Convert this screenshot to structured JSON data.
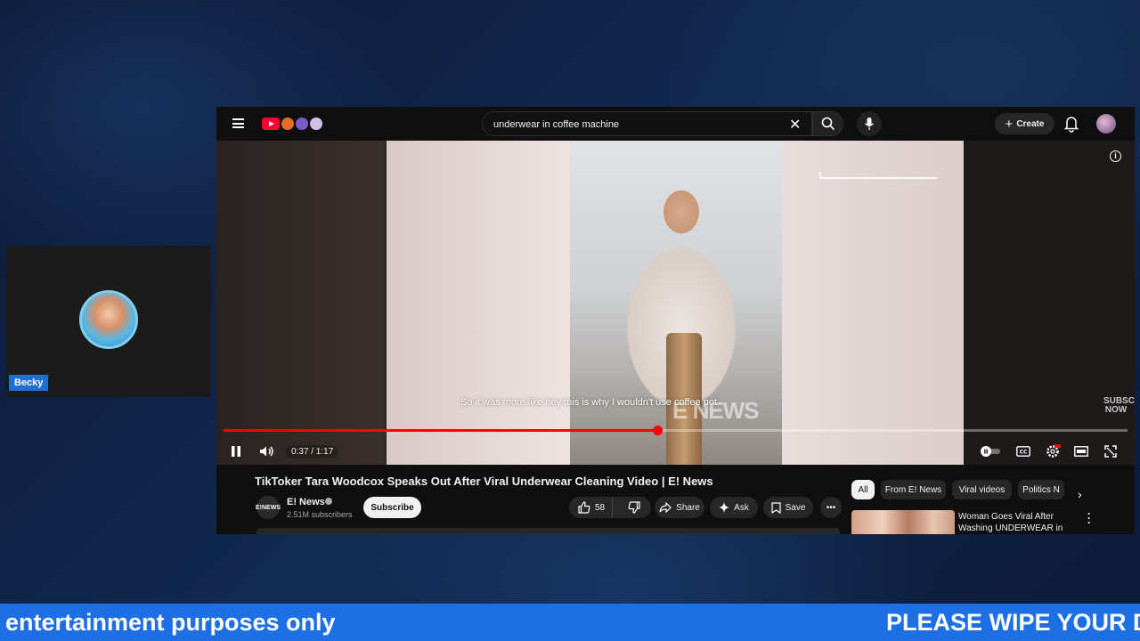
{
  "webcam": {
    "name": "Becky"
  },
  "youtube": {
    "search": {
      "value": "underwear in coffee machine",
      "placeholder": "Search"
    },
    "create_label": "Create",
    "video": {
      "caption": "So it was more like hey this is why I wouldn't use coffee pot",
      "watermark": "E NEWS",
      "subscribe_now": "SUBSCRIBE NOW",
      "time": "0:37 / 1:17",
      "progress": 0.48
    },
    "title": "TikToker Tara Woodcox Speaks Out After Viral Underwear Cleaning Video | E! News",
    "channel": {
      "avatar_text": "E!NEWS",
      "name": "E! News",
      "subscribers": "2.51M subscribers"
    },
    "subscribe_label": "Subscribe",
    "actions": {
      "likes": "58",
      "share": "Share",
      "ask": "Ask",
      "save": "Save"
    },
    "chips": [
      "All",
      "From E! News",
      "Viral videos",
      "Politics N"
    ],
    "recommendation": {
      "title": "Woman Goes Viral After Washing UNDERWEAR in Hote..."
    }
  },
  "ticker": {
    "left_text": "entertainment purposes only",
    "right_text": "PLEASE WIPE YOUR DI"
  },
  "colors": {
    "ticker": "#1d6fe3",
    "progress": "#ff0000",
    "yt_bg": "#0f0f0f"
  }
}
